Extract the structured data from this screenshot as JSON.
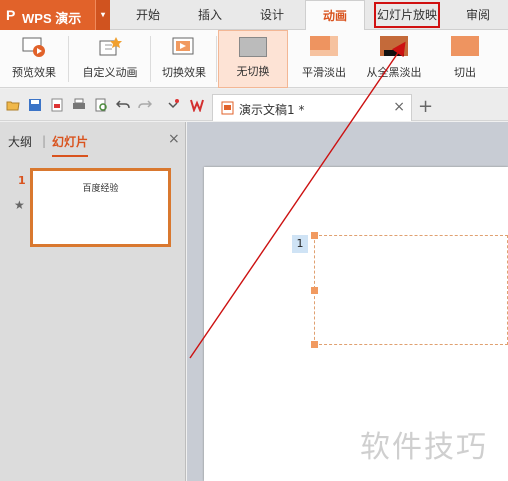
{
  "app": {
    "logo_glyph": "P",
    "name": "WPS 演示",
    "dropdown_glyph": "▾"
  },
  "menu": {
    "tabs": [
      {
        "label": "开始"
      },
      {
        "label": "插入"
      },
      {
        "label": "设计"
      },
      {
        "label": "动画",
        "active": true
      },
      {
        "label": "幻灯片放映",
        "highlighted": true
      },
      {
        "label": "审阅"
      }
    ]
  },
  "ribbon": {
    "items": [
      {
        "label": "预览效果",
        "icon": "preview-icon"
      },
      {
        "label": "自定义动画",
        "icon": "custom-animation-icon"
      },
      {
        "label": "切换效果",
        "icon": "transition-effect-icon"
      },
      {
        "label": "无切换",
        "icon": "no-transition-thumb",
        "selected": true
      },
      {
        "label": "平滑淡出",
        "icon": "fade-smooth-thumb"
      },
      {
        "label": "从全黑淡出",
        "icon": "fade-from-black-thumb"
      },
      {
        "label": "切出",
        "icon": "cut-out-thumb"
      }
    ]
  },
  "quick_access": {
    "icons": [
      "open-folder-icon",
      "save-icon",
      "export-pdf-icon",
      "print-icon",
      "print-preview-icon",
      "undo-icon",
      "redo-icon",
      "customize-dropdown-icon",
      "wps-logo-icon"
    ]
  },
  "document_tab": {
    "title": "演示文稿1 *",
    "close_glyph": "×",
    "new_tab_glyph": "+"
  },
  "left_panel": {
    "tabs": [
      {
        "label": "大纲"
      },
      {
        "label": "幻灯片",
        "active": true
      }
    ],
    "divider": "|",
    "close_glyph": "×",
    "slides": [
      {
        "number": "1",
        "title": "百度经验",
        "star_glyph": "★"
      }
    ]
  },
  "editor": {
    "placeholder_number": "1"
  },
  "watermark": "软件技巧",
  "colors": {
    "accent": "#d9531e",
    "annotation": "#cc1111",
    "app_button": "#e1622a"
  }
}
